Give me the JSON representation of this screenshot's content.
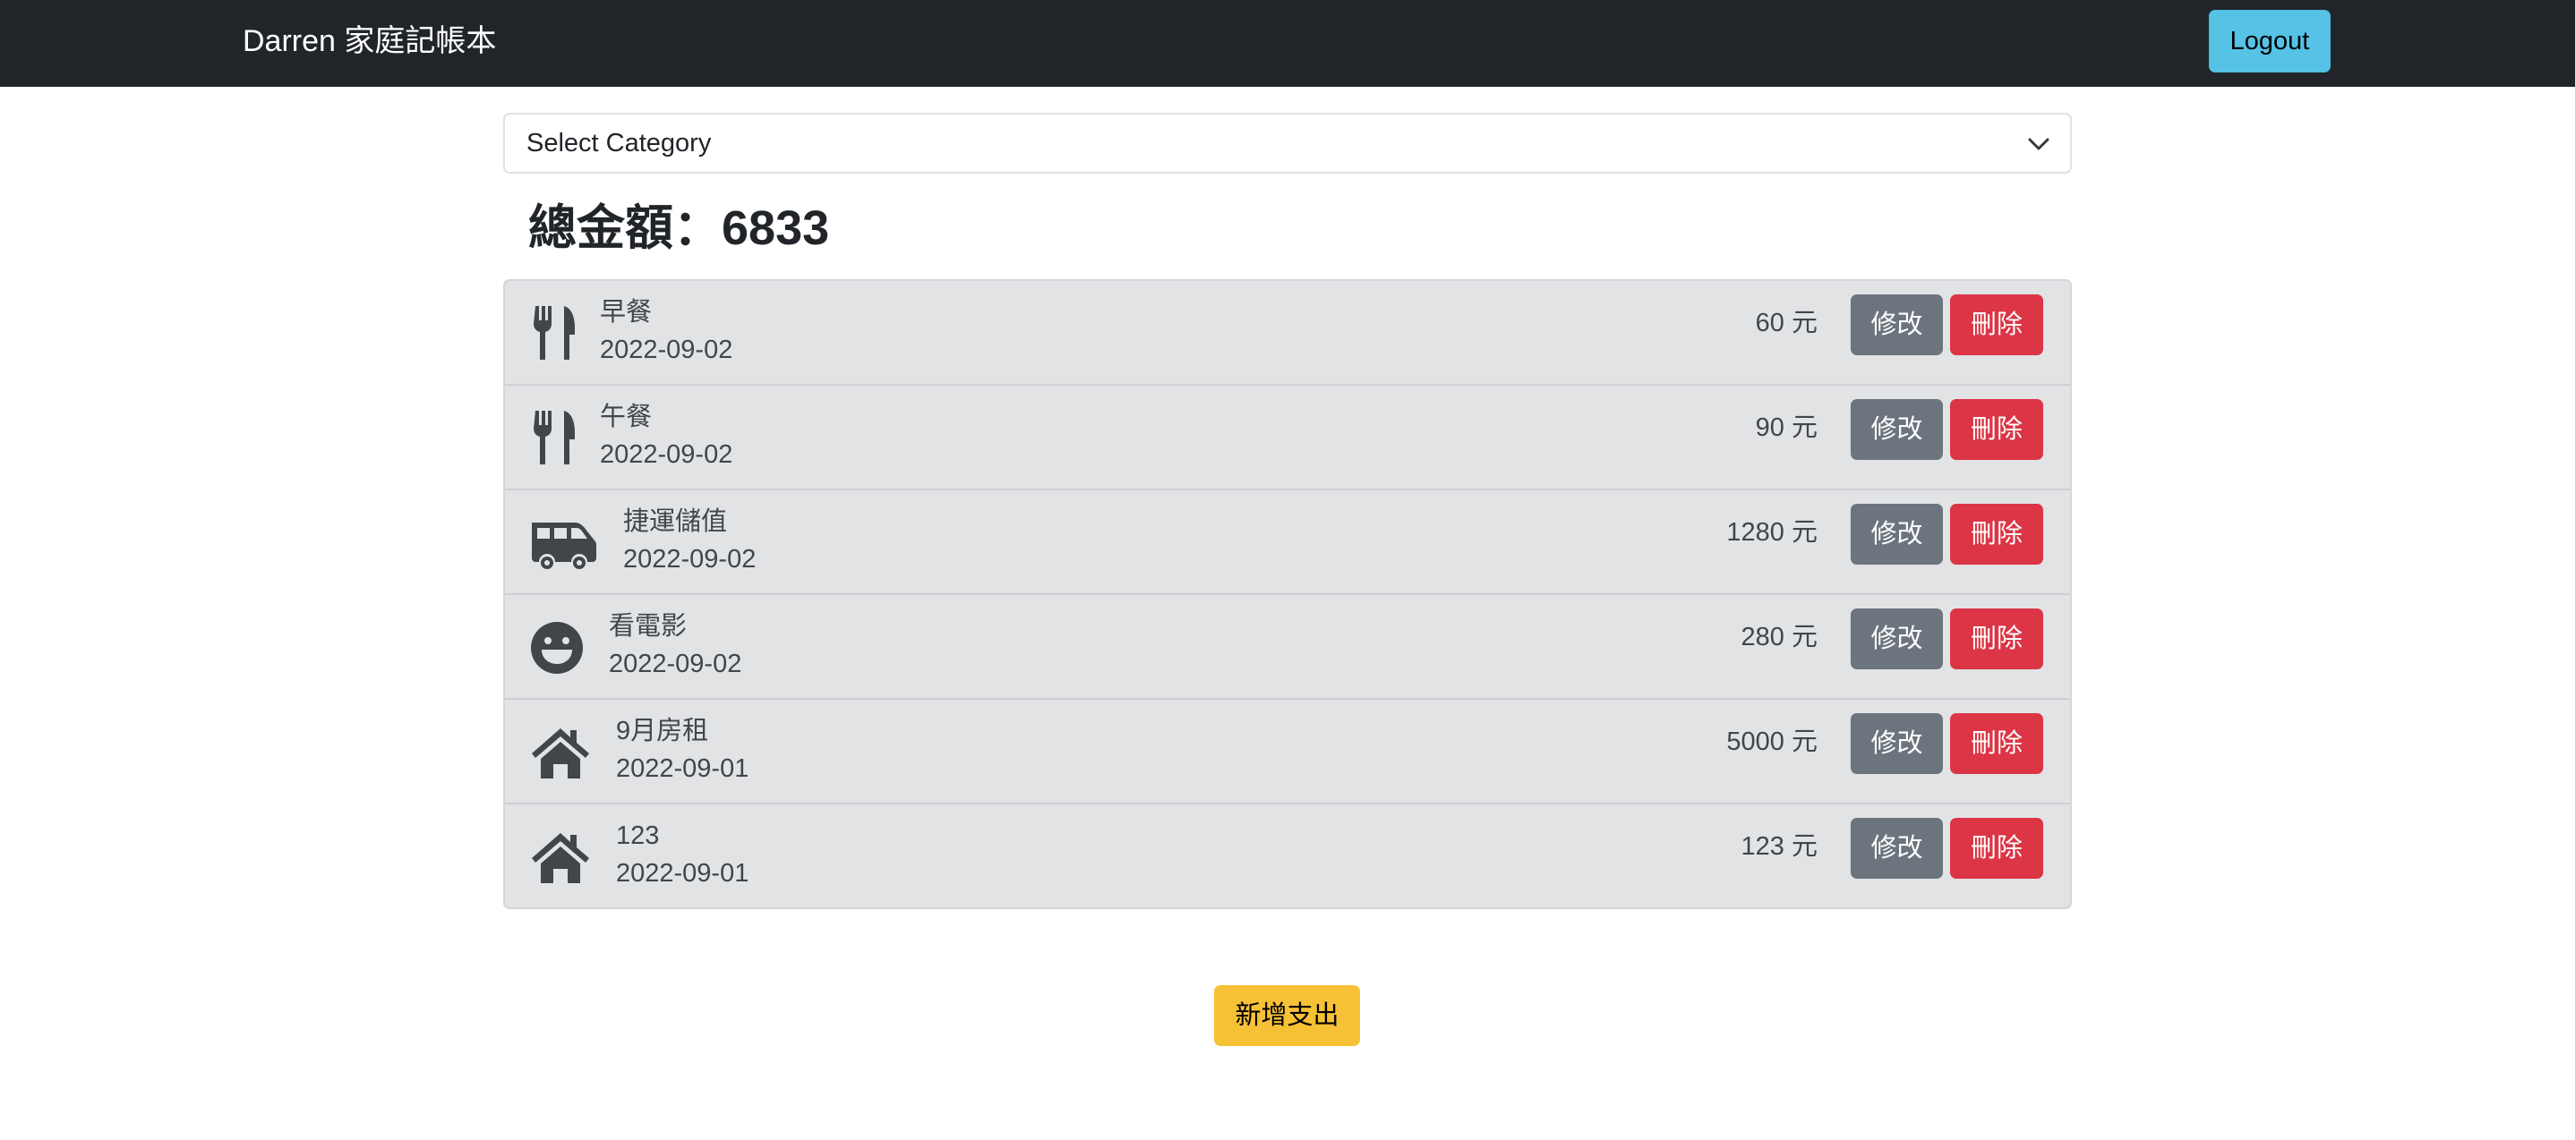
{
  "navbar": {
    "brand": "Darren 家庭記帳本",
    "logout_label": "Logout"
  },
  "filter": {
    "selected": "Select Category"
  },
  "summary": {
    "total_text": "總金額：6833"
  },
  "expenses": [
    {
      "icon": "utensils-icon",
      "name": "早餐",
      "date": "2022-09-02",
      "amount": "60 元"
    },
    {
      "icon": "utensils-icon",
      "name": "午餐",
      "date": "2022-09-02",
      "amount": "90 元"
    },
    {
      "icon": "shuttle-van-icon",
      "name": "捷運儲值",
      "date": "2022-09-02",
      "amount": "1280 元"
    },
    {
      "icon": "smile-icon",
      "name": "看電影",
      "date": "2022-09-02",
      "amount": "280 元"
    },
    {
      "icon": "home-icon",
      "name": "9月房租",
      "date": "2022-09-01",
      "amount": "5000 元"
    },
    {
      "icon": "home-icon",
      "name": "123",
      "date": "2022-09-01",
      "amount": "123 元"
    }
  ],
  "actions": {
    "edit_label": "修改",
    "delete_label": "刪除",
    "add_label": "新增支出"
  },
  "colors": {
    "navbar": "#212529",
    "info": "#55c2e6",
    "secondary": "#6c757d",
    "danger": "#dc3545",
    "warning": "#f7c136",
    "list_bg": "#e2e3e5"
  }
}
